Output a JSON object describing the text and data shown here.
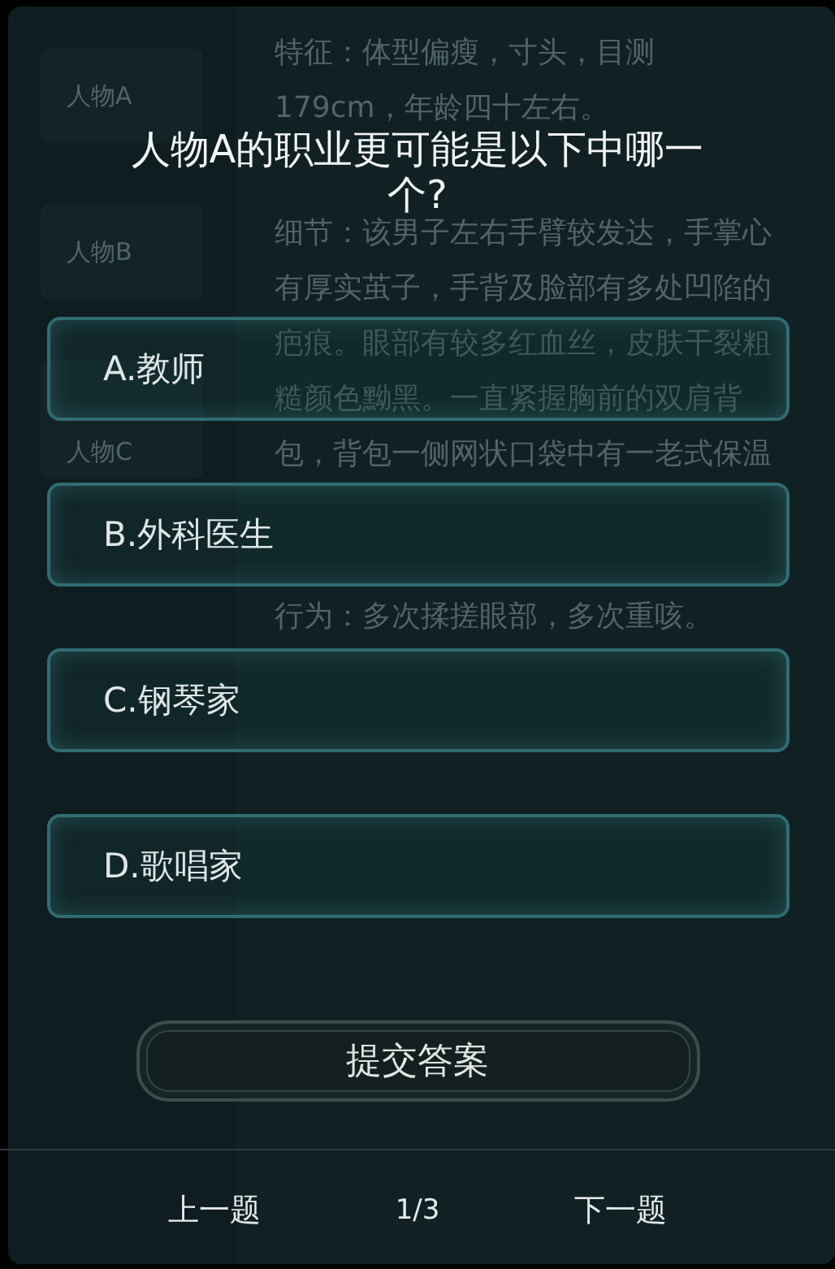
{
  "background": {
    "characters": [
      {
        "label": "人物A"
      },
      {
        "label": "人物B"
      },
      {
        "label": "人物C"
      }
    ],
    "paragraphs": [
      [
        "特征：体型偏瘦，寸头，目测",
        "179cm，年龄四十左右。"
      ],
      [
        "细节：该男子左右手臂较发达，手掌心",
        "有厚实茧子，手背及脸部有多处凹陷的",
        "疤痕。眼部有较多红血丝，皮肤干裂粗",
        "糙颜色黝黑。一直紧握胸前的双肩背",
        "包，背包一侧网状口袋中有一老式保温"
      ],
      [
        "行为：多次揉搓眼部，多次重咳。"
      ]
    ]
  },
  "question": {
    "text": "人物A的职业更可能是以下中哪一个?",
    "options": [
      {
        "label": "A.教师",
        "selected": false
      },
      {
        "label": "B.外科医生",
        "selected": false
      },
      {
        "label": "C.钢琴家",
        "selected": false
      },
      {
        "label": "D.歌唱家",
        "selected": false
      }
    ]
  },
  "submit_button": "提交答案",
  "footer": {
    "prev": "上一题",
    "page": "1/3",
    "next": "下一题"
  }
}
